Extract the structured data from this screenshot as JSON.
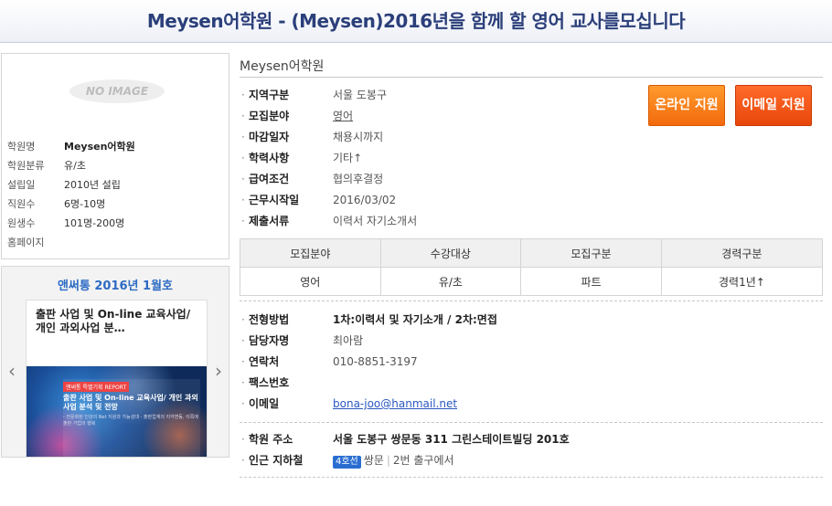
{
  "header": {
    "title": "Meysen어학원 - (Meysen)2016년을 함께 할 영어 교사를모십니다"
  },
  "sidebar": {
    "no_image": "NO IMAGE",
    "info": [
      {
        "label": "학원명",
        "value": "Meysen어학원"
      },
      {
        "label": "학원분류",
        "value": "유/초"
      },
      {
        "label": "설립일",
        "value": "2010년 설립"
      },
      {
        "label": "직원수",
        "value": "6명-10명"
      },
      {
        "label": "원생수",
        "value": "101명-200명"
      },
      {
        "label": "홈페이지",
        "value": ""
      }
    ],
    "promo": {
      "title": "앤써통 2016년 1월호",
      "card_text": "출판 사업 및 On-line 교육사업/개인 과외사업 분…",
      "image_tag": "앤써통 특별기획 REPORT",
      "image_head": "출판 사업 및 On-line 교육사업/ 개인 과외사업 분석 및 전망",
      "image_sub": "- 전문화된 인강의 Net 지원과 가능성대 - 출판업계의 지각변동, 이쪽에 출판 가업의 행복"
    }
  },
  "main": {
    "academy_name": "Meysen어학원",
    "fields": [
      {
        "label": "지역구분",
        "value": "서울 도봉구"
      },
      {
        "label": "모집분야",
        "value": "영어"
      },
      {
        "label": "마감일자",
        "value": "채용시까지"
      },
      {
        "label": "학력사항",
        "value": "기타↑"
      },
      {
        "label": "급여조건",
        "value": "협의후결정"
      },
      {
        "label": "근무시작일",
        "value": "2016/03/02"
      },
      {
        "label": "제출서류",
        "value": "이력서  자기소개서"
      }
    ],
    "buttons": {
      "online": "온라인 지원",
      "email": "이메일 지원"
    },
    "table": {
      "headers": [
        "모집분야",
        "수강대상",
        "모집구분",
        "경력구분"
      ],
      "row": [
        "영어",
        "유/초",
        "파트",
        "경력1년↑"
      ]
    },
    "contact": [
      {
        "label": "전형방법",
        "value": "1차:이력서 및 자기소개  / 2차:면접"
      },
      {
        "label": "담당자명",
        "value": "최아람"
      },
      {
        "label": "연락처",
        "value": "010-8851-3197"
      },
      {
        "label": "팩스번호",
        "value": ""
      },
      {
        "label": "이메일",
        "value": "bona-joo@hanmail.net"
      }
    ],
    "location": {
      "address_label": "학원 주소",
      "address": "서울 도봉구 쌍문동 311 그린스테이트빌딩 201호",
      "subway_label": "인근 지하철",
      "subway_line": "4호선",
      "subway_station": "쌍문",
      "subway_exit": "2번 출구에서"
    }
  }
}
